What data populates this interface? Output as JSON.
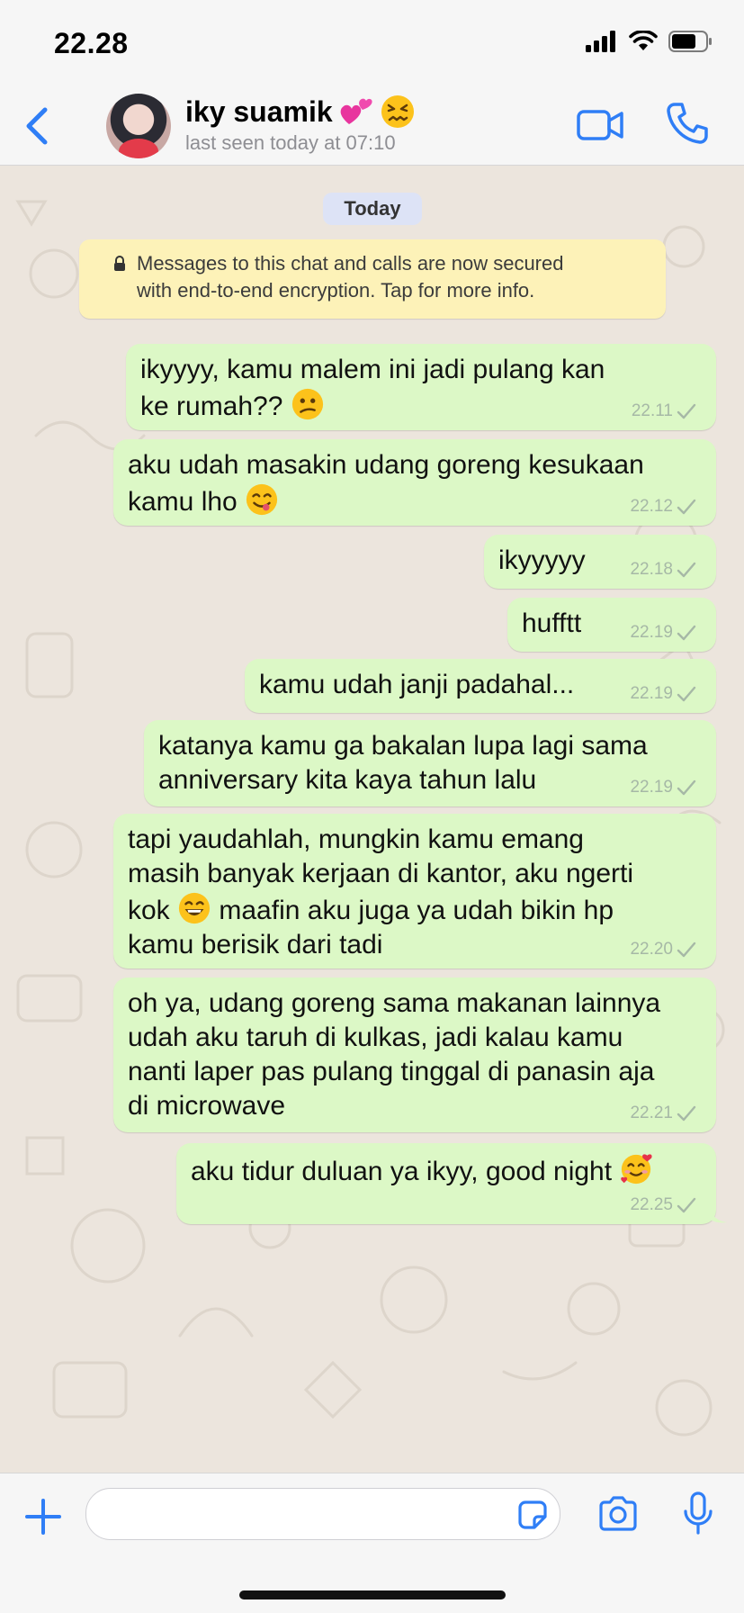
{
  "status_bar": {
    "time": "22.28",
    "icons": [
      "signal-icon",
      "wifi-icon",
      "battery-icon"
    ]
  },
  "header": {
    "back_icon": "chevron-left-icon",
    "contact_name": "iky suamik",
    "name_emojis": [
      "two-hearts-emoji",
      "confounded-face-emoji"
    ],
    "last_seen": "last seen today at 07:10",
    "actions": [
      "video-call-icon",
      "phone-call-icon"
    ]
  },
  "chat": {
    "date_chip": "Today",
    "encryption_notice": {
      "line1": "Messages to this chat and calls are now secured",
      "line2": "with end-to-end encryption. Tap for more info."
    },
    "messages": [
      {
        "lines": [
          "ikyyyy, kamu malem ini jadi pulang kan",
          "ke rumah??"
        ],
        "time": "22.11",
        "emoji": "confused-face",
        "status": "sent"
      },
      {
        "lines": [
          "aku udah masakin udang goreng kesukaan",
          "kamu lho"
        ],
        "time": "22.12",
        "emoji": "savoring-food-face",
        "status": "sent"
      },
      {
        "lines": [
          "ikyyyyy"
        ],
        "time": "22.18",
        "status": "sent"
      },
      {
        "lines": [
          "hufftt"
        ],
        "time": "22.19",
        "status": "sent"
      },
      {
        "lines": [
          "kamu udah janji padahal..."
        ],
        "time": "22.19",
        "status": "sent"
      },
      {
        "lines": [
          "katanya kamu ga bakalan lupa lagi sama",
          "anniversary kita kaya tahun lalu"
        ],
        "time": "22.19",
        "status": "sent"
      },
      {
        "lines": [
          "tapi yaudahlah, mungkin kamu emang",
          "masih banyak kerjaan di kantor, aku ngerti",
          "kok",
          "maafin aku juga ya udah bikin hp",
          "kamu berisik dari tadi"
        ],
        "time": "22.20",
        "emoji": "grinning-face",
        "status": "sent"
      },
      {
        "lines": [
          "oh ya, udang goreng sama makanan lainnya",
          "udah aku taruh di kulkas, jadi kalau kamu",
          "nanti laper pas pulang tinggal di panasin aja",
          "di microwave"
        ],
        "time": "22.21",
        "status": "sent"
      },
      {
        "lines": [
          "aku tidur duluan ya ikyy, good night"
        ],
        "time": "22.25",
        "emoji": "smiling-face-with-hearts",
        "status": "sent"
      }
    ]
  },
  "input_bar": {
    "message_value": "",
    "icons": [
      "plus-icon",
      "sticker-icon",
      "camera-icon",
      "microphone-icon"
    ]
  },
  "colors": {
    "accent": "#2f7ef6",
    "outgoing_bubble": "#dcf8c6",
    "chat_background": "#ece5dd",
    "notice_background": "#fdf2b8",
    "date_chip": "#dde3f6"
  }
}
